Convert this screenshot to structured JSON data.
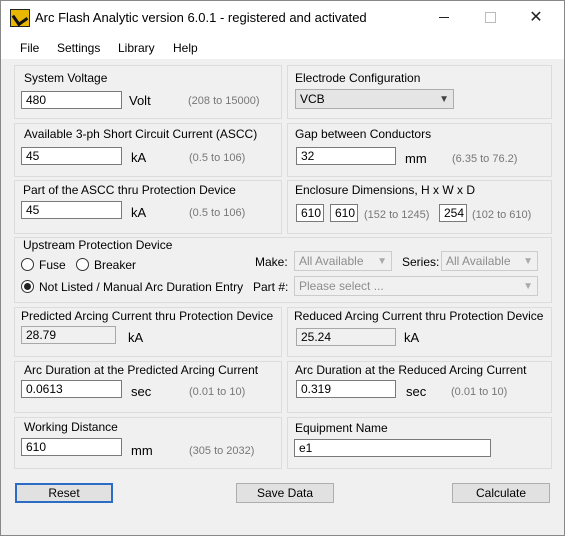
{
  "window": {
    "title": "Arc Flash Analytic version 6.0.1 - registered and activated",
    "minimize": "",
    "maximize": "",
    "close": "✕"
  },
  "menu": [
    "File",
    "Settings",
    "Library",
    "Help"
  ],
  "system_voltage": {
    "label": "System Voltage",
    "value": "480",
    "unit": "Volt",
    "range": "(208 to 15000)"
  },
  "electrode": {
    "label": "Electrode Configuration",
    "value": "VCB"
  },
  "ascc": {
    "label": "Available 3-ph Short Circuit Current (ASCC)",
    "value": "45",
    "unit": "kA",
    "range": "(0.5 to 106)"
  },
  "gap": {
    "label": "Gap between Conductors",
    "value": "32",
    "unit": "mm",
    "range": "(6.35 to 76.2)"
  },
  "ascc_part": {
    "label": "Part of the ASCC thru Protection Device",
    "value": "45",
    "unit": "kA",
    "range": "(0.5 to 106)"
  },
  "enclosure": {
    "label": "Enclosure Dimensions, H x W x D",
    "h": "610",
    "w": "610",
    "hw_range": "(152 to 1245)",
    "d": "254",
    "d_range": "(102 to 610)"
  },
  "upstream": {
    "label": "Upstream Protection Device",
    "fuse": "Fuse",
    "breaker": "Breaker",
    "not_listed": "Not Listed / Manual Arc Duration Entry",
    "selected": "not_listed",
    "make_label": "Make:",
    "make_value": "All Available",
    "series_label": "Series:",
    "series_value": "All Available",
    "part_label": "Part #:",
    "part_value": "Please select ..."
  },
  "pred_arcing": {
    "label": "Predicted Arcing Current thru Protection Device",
    "value": "28.79",
    "unit": "kA"
  },
  "red_arcing": {
    "label": "Reduced Arcing Current thru Protection Device",
    "value": "25.24",
    "unit": "kA"
  },
  "pred_duration": {
    "label": "Arc Duration at the Predicted Arcing Current",
    "value": "0.0613",
    "unit": "sec",
    "range": "(0.01 to 10)"
  },
  "red_duration": {
    "label": "Arc Duration at the Reduced Arcing Current",
    "value": "0.319",
    "unit": "sec",
    "range": "(0.01 to 10)"
  },
  "working_distance": {
    "label": "Working Distance",
    "value": "610",
    "unit": "mm",
    "range": "(305 to 2032)"
  },
  "equipment": {
    "label": "Equipment Name",
    "value": "e1"
  },
  "buttons": {
    "reset": "Reset",
    "save": "Save Data",
    "calculate": "Calculate"
  }
}
